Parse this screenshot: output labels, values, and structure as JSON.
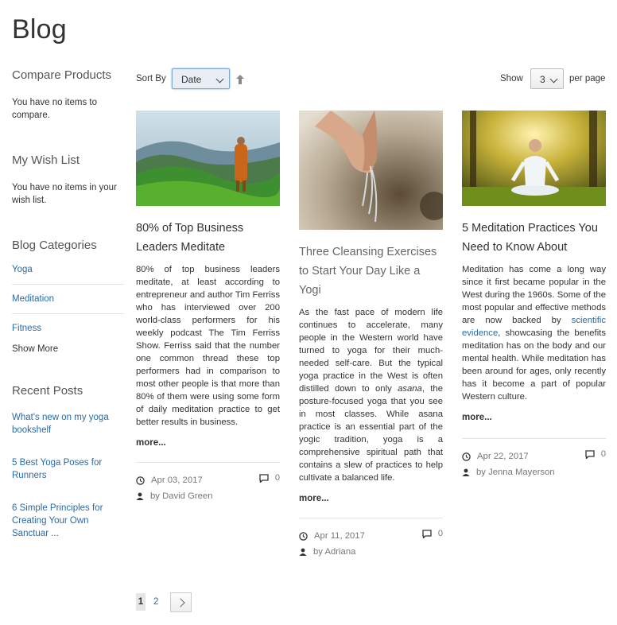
{
  "page": {
    "title": "Blog"
  },
  "sidebar": {
    "compare": {
      "title": "Compare Products",
      "text": "You have no items to compare."
    },
    "wishlist": {
      "title": "My Wish List",
      "text": "You have no items in your wish list."
    },
    "categories": {
      "title": "Blog Categories",
      "items": [
        "Yoga",
        "Meditation",
        "Fitness"
      ],
      "show_more": "Show More"
    },
    "recent": {
      "title": "Recent Posts",
      "items": [
        "What's new on my yoga bookshelf",
        "5 Best Yoga Poses for Runners",
        "6 Simple Principles for Creating Your Own Sanctuar ..."
      ]
    }
  },
  "toolbar": {
    "sort_label": "Sort By",
    "sort_value": "Date",
    "sort_direction_icon": "arrow-up-icon",
    "show_label": "Show",
    "limit_value": "3",
    "per_page_label": "per page"
  },
  "posts": [
    {
      "image": "monk-on-green-hills-image",
      "title": "80% of Top Business Leaders Meditate",
      "body": "80% of top business leaders meditate, at least according to entrepreneur and author Tim Ferriss who has interviewed over 200 world-class performers for his weekly podcast The Tim Ferriss Show.  Ferriss said that the number one common thread these top performers had in comparison to most other people is that more than 80% of them were using some form of daily meditation practice to get better results in business.",
      "more": "more...",
      "date": "Apr 03, 2017",
      "comments": "0",
      "author": "by David Green"
    },
    {
      "image": "hands-with-water-image",
      "title": "Three Cleansing Exercises to Start Your Day Like a Yogi",
      "body_pre": "As the fast pace of modern life continues to accelerate, many people in the Western world have turned to yoga for their much-needed self-care. But the typical yoga practice in the West is often distilled down to only ",
      "body_em": "asana",
      "body_post": ", the posture-focused yoga that you see in most classes. While asana practice is an essential part of the yogic tradition, yoga is a comprehensive spiritual path that contains a slew of practices to help cultivate a balanced life.",
      "more": "more...",
      "date": "Apr 11, 2017",
      "comments": "0",
      "author": "by Adriana"
    },
    {
      "image": "woman-meditating-in-park-image",
      "title": "5 Meditation Practices You Need to Know About",
      "body_pre": "Meditation has come a long way since it first became popular in the West during the 1960s. Some of the most popular and effective methods are now backed by ",
      "body_link": "scientific evidence",
      "body_post": ", showcasing the benefits meditation has on the body and our mental health. While meditation has been around for ages, only recently has it become a part of popular Western culture.",
      "more": "more...",
      "date": "Apr 22, 2017",
      "comments": "0",
      "author": "by Jenna Mayerson"
    }
  ],
  "pager": {
    "current": "1",
    "next_page": "2",
    "next_icon": "chevron-right-icon"
  },
  "colors": {
    "link": "#2b6aa3",
    "text": "#333333",
    "muted": "#777777"
  }
}
